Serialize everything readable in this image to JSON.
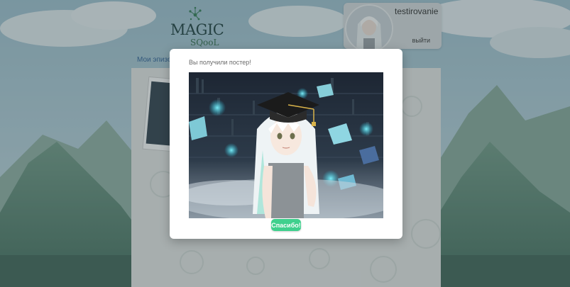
{
  "header": {
    "logo_main": "MAGIC",
    "logo_sub": "SQooL",
    "username": "testirovanie",
    "logout_label": "выйти"
  },
  "nav": {
    "episodes_link": "Мои эпизоды"
  },
  "modal": {
    "title": "Вы получили постер!",
    "thanks_button": "Спасибо!"
  },
  "colors": {
    "accent_green": "#3fd08d",
    "link_blue": "#2d5f97"
  }
}
